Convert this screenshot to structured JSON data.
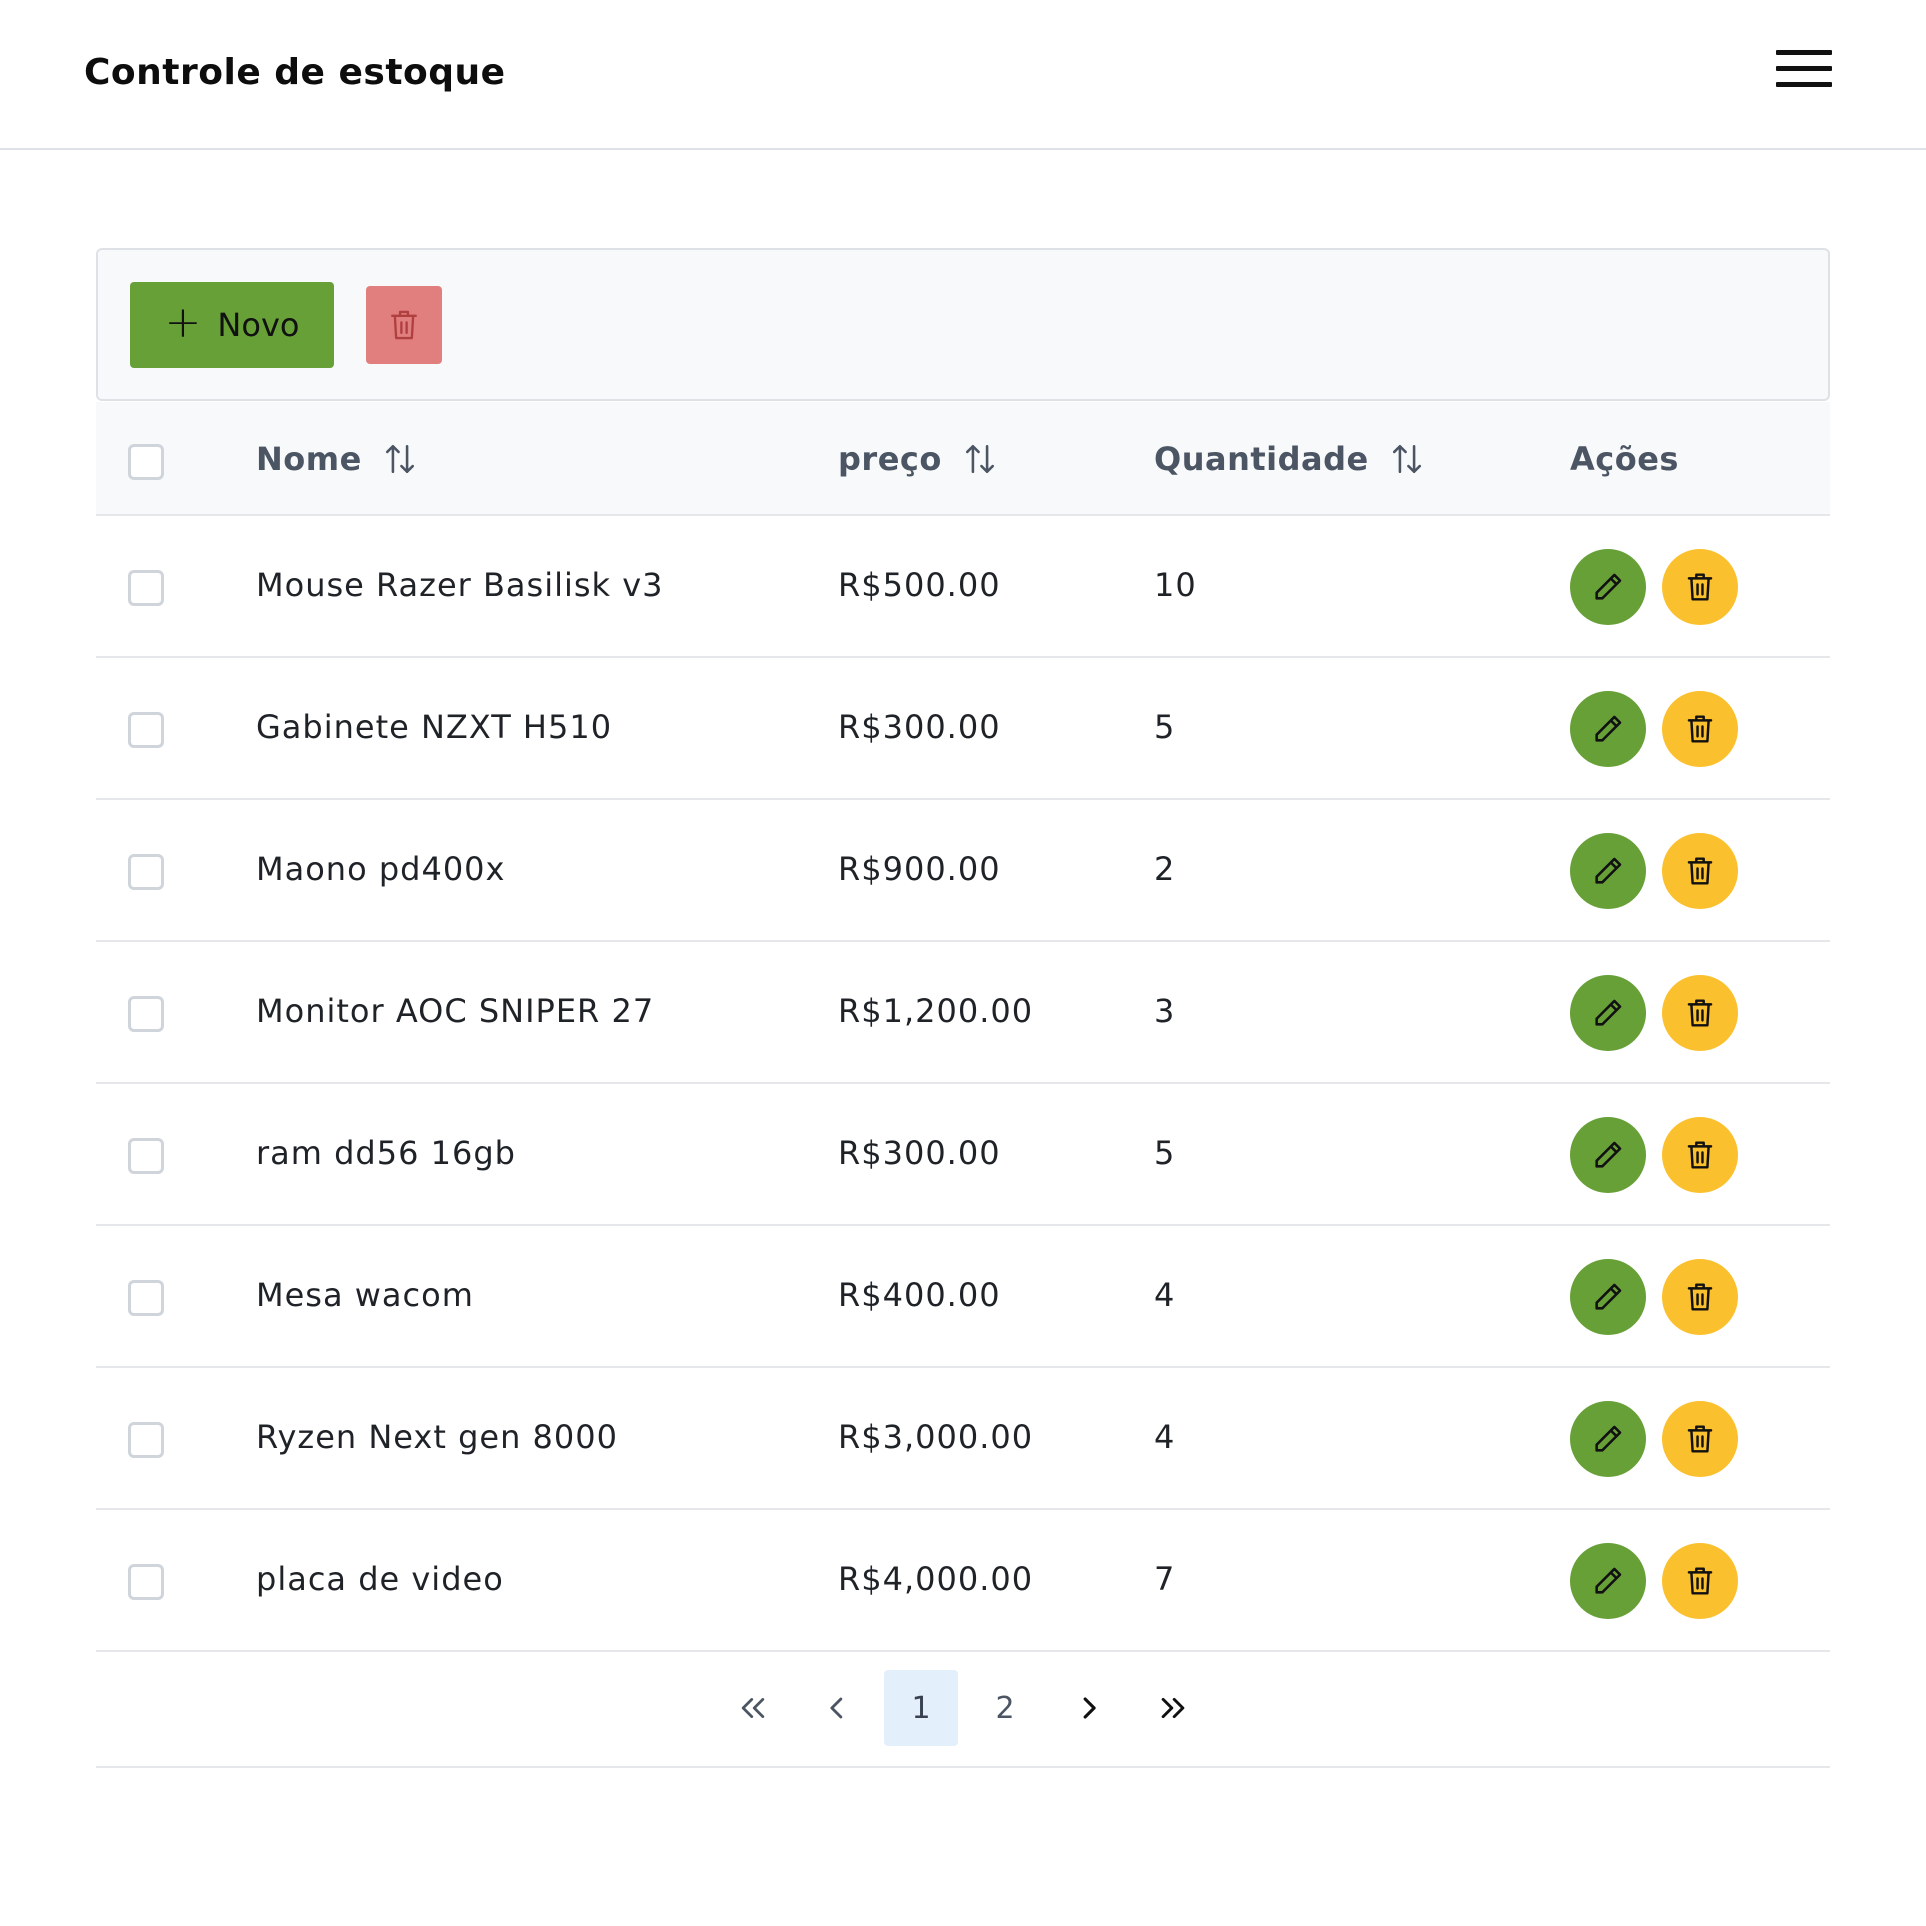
{
  "header": {
    "title": "Controle de estoque",
    "menu_icon": "hamburger-menu-icon"
  },
  "toolbar": {
    "new_label": "Novo",
    "new_icon": "plus-icon",
    "delete_icon": "trash-icon"
  },
  "colors": {
    "green": "#68a038",
    "yellow": "#fbc02d",
    "danger": "#e17f7f",
    "active_page": "#e3f0fb"
  },
  "table": {
    "columns": {
      "nome": "Nome",
      "preco": "preço",
      "quantidade": "Quantidade",
      "acoes": "Ações"
    },
    "rows": [
      {
        "nome": "Mouse Razer Basilisk v3",
        "preco": "R$500.00",
        "quantidade": "10"
      },
      {
        "nome": "Gabinete NZXT H510",
        "preco": "R$300.00",
        "quantidade": "5"
      },
      {
        "nome": "Maono pd400x",
        "preco": "R$900.00",
        "quantidade": "2"
      },
      {
        "nome": "Monitor AOC SNIPER 27",
        "preco": "R$1,200.00",
        "quantidade": "3"
      },
      {
        "nome": "ram dd56 16gb",
        "preco": "R$300.00",
        "quantidade": "5"
      },
      {
        "nome": "Mesa wacom",
        "preco": "R$400.00",
        "quantidade": "4"
      },
      {
        "nome": "Ryzen Next gen 8000",
        "preco": "R$3,000.00",
        "quantidade": "4"
      },
      {
        "nome": "placa de video",
        "preco": "R$4,000.00",
        "quantidade": "7"
      }
    ]
  },
  "pagination": {
    "pages": [
      "1",
      "2"
    ],
    "current": "1"
  }
}
